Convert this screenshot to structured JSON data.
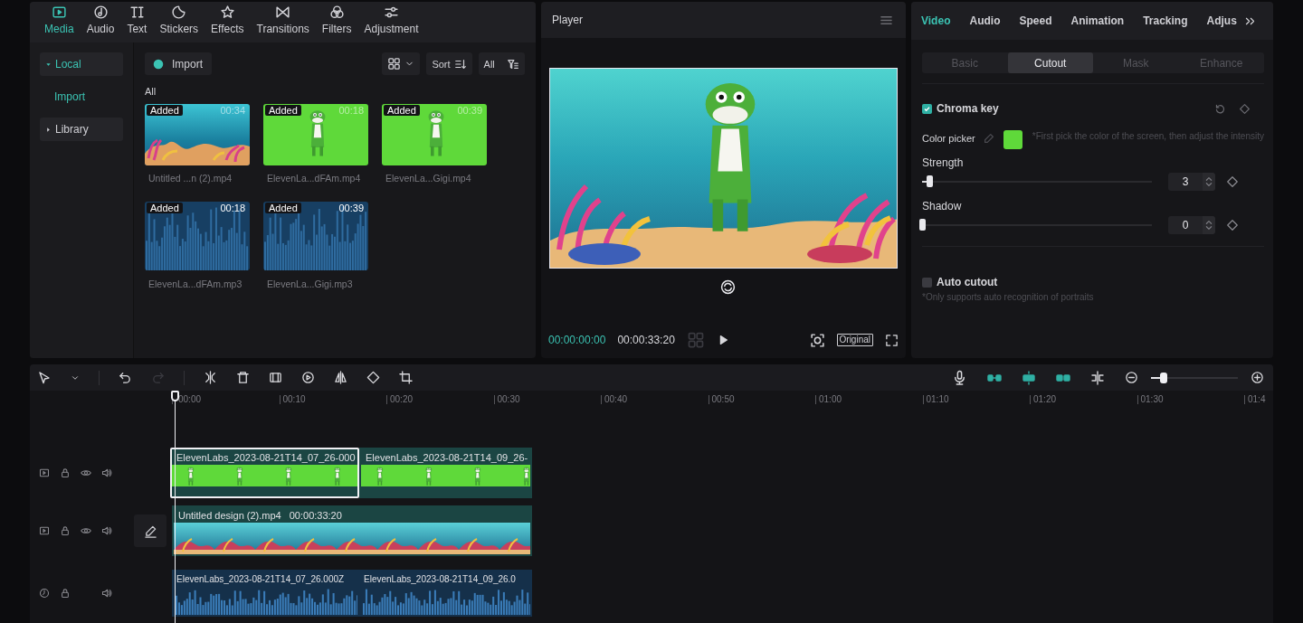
{
  "media_panel": {
    "tabs": [
      {
        "label": "Media",
        "selected": true
      },
      {
        "label": "Audio",
        "selected": false
      },
      {
        "label": "Text",
        "selected": false
      },
      {
        "label": "Stickers",
        "selected": false
      },
      {
        "label": "Effects",
        "selected": false
      },
      {
        "label": "Transitions",
        "selected": false
      },
      {
        "label": "Filters",
        "selected": false
      },
      {
        "label": "Adjustment",
        "selected": false
      }
    ],
    "sidebar": [
      {
        "label": "Local",
        "kind": "group",
        "expanded": true
      },
      {
        "label": "Import",
        "kind": "leaf",
        "selected": true
      },
      {
        "label": "Library",
        "kind": "group",
        "expanded": false
      }
    ],
    "import_button": "Import",
    "view_toggle": {
      "expanded": false
    },
    "sort_button": "Sort",
    "all_button": "All",
    "filter_label": "All",
    "items": [
      {
        "kind": "ocean",
        "badge": "Added",
        "duration": "00:34",
        "filename": "Untitled ...n (2).mp4"
      },
      {
        "kind": "greenscreen",
        "badge": "Added",
        "duration": "00:18",
        "filename": "ElevenLa...dFAm.mp4"
      },
      {
        "kind": "greenscreen",
        "badge": "Added",
        "duration": "00:39",
        "filename": "ElevenLa...Gigi.mp4"
      },
      {
        "kind": "audio",
        "badge": "Added",
        "duration": "00:18",
        "filename": "ElevenLa...dFAm.mp3"
      },
      {
        "kind": "audio",
        "badge": "Added",
        "duration": "00:39",
        "filename": "ElevenLa...Gigi.mp3"
      }
    ]
  },
  "player": {
    "title": "Player",
    "current_time": "00:00:00:00",
    "total_time": "00:00:33:20",
    "ratio_button": "Original"
  },
  "inspector": {
    "tabs": [
      {
        "label": "Video",
        "selected": true
      },
      {
        "label": "Audio",
        "selected": false
      },
      {
        "label": "Speed",
        "selected": false
      },
      {
        "label": "Animation",
        "selected": false
      },
      {
        "label": "Tracking",
        "selected": false
      },
      {
        "label": "Adjus",
        "selected": false
      }
    ],
    "subtabs": [
      {
        "label": "Basic",
        "selected": false
      },
      {
        "label": "Cutout",
        "selected": true
      },
      {
        "label": "Mask",
        "selected": false
      },
      {
        "label": "Enhance",
        "selected": false
      }
    ],
    "chroma_key": {
      "label": "Chroma key",
      "checked": true
    },
    "color_picker": {
      "label": "Color picker",
      "color": "#5fd93a",
      "hint": "*First pick the color of the screen, then adjust the intensity"
    },
    "sliders": [
      {
        "label": "Strength",
        "level": 0.03,
        "value": "3"
      },
      {
        "label": "Shadow",
        "level": 0,
        "value": "0"
      }
    ],
    "auto_cutout": {
      "label": "Auto cutout",
      "checked": false,
      "note": "*Only supports auto recognition of portraits"
    }
  },
  "timeline": {
    "ruler": [
      "00:00",
      "00:10",
      "00:20",
      "00:30",
      "00:40",
      "00:50",
      "01:00",
      "01:10",
      "01:20",
      "01:30",
      "01:4"
    ],
    "zoom_slider": {
      "level": 0.15
    },
    "tracks": [
      {
        "kind": "overlay",
        "clips": [
          {
            "kind": "greenscreen",
            "label": "ElevenLabs_2023-08-21T14_07_26-000",
            "selected": true
          },
          {
            "kind": "greenscreen",
            "label": "ElevenLabs_2023-08-21T14_09_26-",
            "selected": false
          }
        ]
      },
      {
        "kind": "main",
        "clips": [
          {
            "kind": "ocean",
            "label": "Untitled design (2).mp4",
            "duration": "00:00:33:20",
            "selected": false
          }
        ]
      },
      {
        "kind": "audio",
        "clips": [
          {
            "kind": "audio",
            "label": "ElevenLabs_2023-08-21T14_07_26.000Z",
            "selected": false
          },
          {
            "kind": "audio",
            "label": "ElevenLabs_2023-08-21T14_09_26.0",
            "selected": false
          }
        ]
      }
    ]
  }
}
